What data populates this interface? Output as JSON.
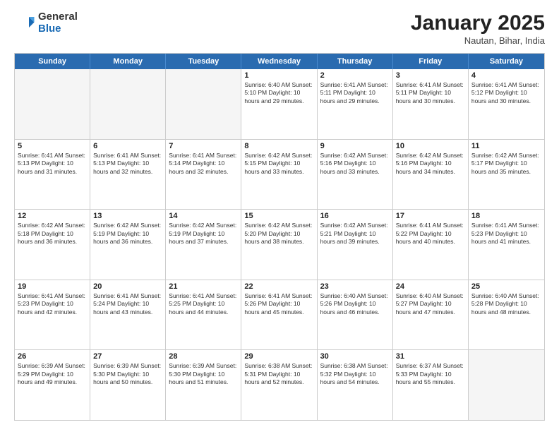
{
  "header": {
    "logo_general": "General",
    "logo_blue": "Blue",
    "month_title": "January 2025",
    "location": "Nautan, Bihar, India"
  },
  "day_names": [
    "Sunday",
    "Monday",
    "Tuesday",
    "Wednesday",
    "Thursday",
    "Friday",
    "Saturday"
  ],
  "weeks": [
    [
      {
        "num": "",
        "info": ""
      },
      {
        "num": "",
        "info": ""
      },
      {
        "num": "",
        "info": ""
      },
      {
        "num": "1",
        "info": "Sunrise: 6:40 AM\nSunset: 5:10 PM\nDaylight: 10 hours\nand 29 minutes."
      },
      {
        "num": "2",
        "info": "Sunrise: 6:41 AM\nSunset: 5:11 PM\nDaylight: 10 hours\nand 29 minutes."
      },
      {
        "num": "3",
        "info": "Sunrise: 6:41 AM\nSunset: 5:11 PM\nDaylight: 10 hours\nand 30 minutes."
      },
      {
        "num": "4",
        "info": "Sunrise: 6:41 AM\nSunset: 5:12 PM\nDaylight: 10 hours\nand 30 minutes."
      }
    ],
    [
      {
        "num": "5",
        "info": "Sunrise: 6:41 AM\nSunset: 5:13 PM\nDaylight: 10 hours\nand 31 minutes."
      },
      {
        "num": "6",
        "info": "Sunrise: 6:41 AM\nSunset: 5:13 PM\nDaylight: 10 hours\nand 32 minutes."
      },
      {
        "num": "7",
        "info": "Sunrise: 6:41 AM\nSunset: 5:14 PM\nDaylight: 10 hours\nand 32 minutes."
      },
      {
        "num": "8",
        "info": "Sunrise: 6:42 AM\nSunset: 5:15 PM\nDaylight: 10 hours\nand 33 minutes."
      },
      {
        "num": "9",
        "info": "Sunrise: 6:42 AM\nSunset: 5:16 PM\nDaylight: 10 hours\nand 33 minutes."
      },
      {
        "num": "10",
        "info": "Sunrise: 6:42 AM\nSunset: 5:16 PM\nDaylight: 10 hours\nand 34 minutes."
      },
      {
        "num": "11",
        "info": "Sunrise: 6:42 AM\nSunset: 5:17 PM\nDaylight: 10 hours\nand 35 minutes."
      }
    ],
    [
      {
        "num": "12",
        "info": "Sunrise: 6:42 AM\nSunset: 5:18 PM\nDaylight: 10 hours\nand 36 minutes."
      },
      {
        "num": "13",
        "info": "Sunrise: 6:42 AM\nSunset: 5:19 PM\nDaylight: 10 hours\nand 36 minutes."
      },
      {
        "num": "14",
        "info": "Sunrise: 6:42 AM\nSunset: 5:19 PM\nDaylight: 10 hours\nand 37 minutes."
      },
      {
        "num": "15",
        "info": "Sunrise: 6:42 AM\nSunset: 5:20 PM\nDaylight: 10 hours\nand 38 minutes."
      },
      {
        "num": "16",
        "info": "Sunrise: 6:42 AM\nSunset: 5:21 PM\nDaylight: 10 hours\nand 39 minutes."
      },
      {
        "num": "17",
        "info": "Sunrise: 6:41 AM\nSunset: 5:22 PM\nDaylight: 10 hours\nand 40 minutes."
      },
      {
        "num": "18",
        "info": "Sunrise: 6:41 AM\nSunset: 5:23 PM\nDaylight: 10 hours\nand 41 minutes."
      }
    ],
    [
      {
        "num": "19",
        "info": "Sunrise: 6:41 AM\nSunset: 5:23 PM\nDaylight: 10 hours\nand 42 minutes."
      },
      {
        "num": "20",
        "info": "Sunrise: 6:41 AM\nSunset: 5:24 PM\nDaylight: 10 hours\nand 43 minutes."
      },
      {
        "num": "21",
        "info": "Sunrise: 6:41 AM\nSunset: 5:25 PM\nDaylight: 10 hours\nand 44 minutes."
      },
      {
        "num": "22",
        "info": "Sunrise: 6:41 AM\nSunset: 5:26 PM\nDaylight: 10 hours\nand 45 minutes."
      },
      {
        "num": "23",
        "info": "Sunrise: 6:40 AM\nSunset: 5:26 PM\nDaylight: 10 hours\nand 46 minutes."
      },
      {
        "num": "24",
        "info": "Sunrise: 6:40 AM\nSunset: 5:27 PM\nDaylight: 10 hours\nand 47 minutes."
      },
      {
        "num": "25",
        "info": "Sunrise: 6:40 AM\nSunset: 5:28 PM\nDaylight: 10 hours\nand 48 minutes."
      }
    ],
    [
      {
        "num": "26",
        "info": "Sunrise: 6:39 AM\nSunset: 5:29 PM\nDaylight: 10 hours\nand 49 minutes."
      },
      {
        "num": "27",
        "info": "Sunrise: 6:39 AM\nSunset: 5:30 PM\nDaylight: 10 hours\nand 50 minutes."
      },
      {
        "num": "28",
        "info": "Sunrise: 6:39 AM\nSunset: 5:30 PM\nDaylight: 10 hours\nand 51 minutes."
      },
      {
        "num": "29",
        "info": "Sunrise: 6:38 AM\nSunset: 5:31 PM\nDaylight: 10 hours\nand 52 minutes."
      },
      {
        "num": "30",
        "info": "Sunrise: 6:38 AM\nSunset: 5:32 PM\nDaylight: 10 hours\nand 54 minutes."
      },
      {
        "num": "31",
        "info": "Sunrise: 6:37 AM\nSunset: 5:33 PM\nDaylight: 10 hours\nand 55 minutes."
      },
      {
        "num": "",
        "info": ""
      }
    ]
  ]
}
